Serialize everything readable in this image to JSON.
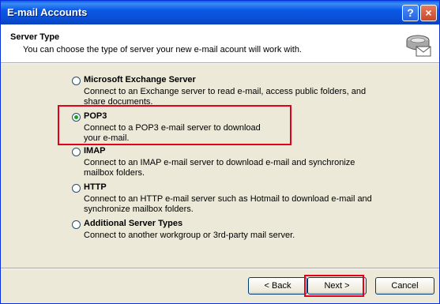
{
  "window": {
    "title": "E-mail Accounts",
    "help_glyph": "?",
    "close_glyph": "×"
  },
  "header": {
    "title": "Server Type",
    "subtitle": "You can choose the type of server your new e-mail acount will work with."
  },
  "options": [
    {
      "label": "Microsoft Exchange Server",
      "desc1": "Connect to an Exchange server to read e-mail, access public folders, and",
      "desc2": "share documents.",
      "checked": false
    },
    {
      "label": "POP3",
      "desc1": "Connect to a POP3 e-mail server to download",
      "desc2": "your e-mail.",
      "checked": true
    },
    {
      "label": "IMAP",
      "desc1": "Connect to an IMAP e-mail server to download e-mail and synchronize",
      "desc2": "mailbox folders.",
      "checked": false
    },
    {
      "label": "HTTP",
      "desc1": "Connect to an HTTP e-mail server such as Hotmail to download e-mail and",
      "desc2": "synchronize mailbox folders.",
      "checked": false
    },
    {
      "label": "Additional Server Types",
      "desc1": "Connect to another workgroup or 3rd-party mail server.",
      "desc2": "",
      "checked": false
    }
  ],
  "buttons": {
    "back": "< Back",
    "next": "Next >",
    "cancel": "Cancel"
  },
  "colors": {
    "titlebar": "#0a4fd6",
    "highlight": "#e2001a",
    "dialog_bg": "#ece9d8"
  },
  "icons": {
    "header": "mail-server-icon"
  }
}
